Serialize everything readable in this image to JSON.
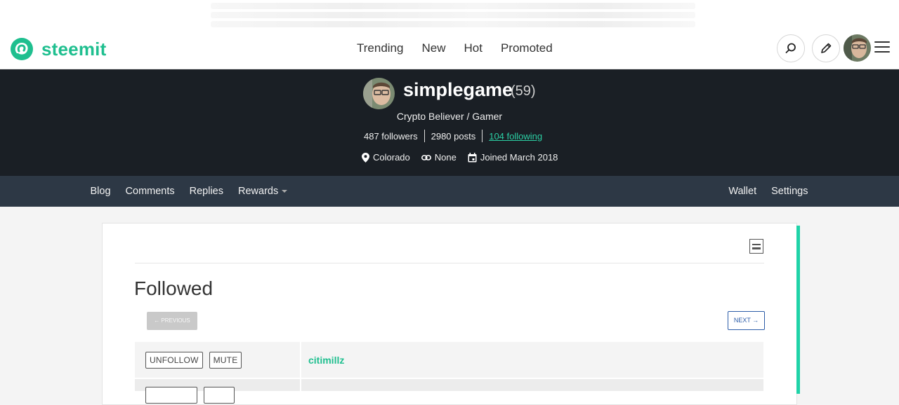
{
  "brand": {
    "name": "steemit",
    "color": "#1fbf8f"
  },
  "header": {
    "nav": [
      "Trending",
      "New",
      "Hot",
      "Promoted"
    ],
    "search_icon": "search-icon",
    "compose_icon": "pencil-icon",
    "menu_icon": "hamburger-menu-icon"
  },
  "profile": {
    "name": "simplegame",
    "reputation": "(59)",
    "about": "Crypto Believer / Gamer",
    "followers": "487 followers",
    "posts": "2980 posts",
    "following": "104 following",
    "location": "Colorado",
    "website": "None",
    "joined": "Joined March 2018"
  },
  "subnav": {
    "left": [
      "Blog",
      "Comments",
      "Replies",
      "Rewards"
    ],
    "right": [
      "Wallet",
      "Settings"
    ]
  },
  "content": {
    "heading": "Followed",
    "prev_label": "← PREVIOUS",
    "next_label": "NEXT →",
    "accent_color": "#1fd3a8",
    "rows": [
      {
        "unfollow": "UNFOLLOW",
        "mute": "MUTE",
        "name": "citimillz"
      }
    ]
  }
}
